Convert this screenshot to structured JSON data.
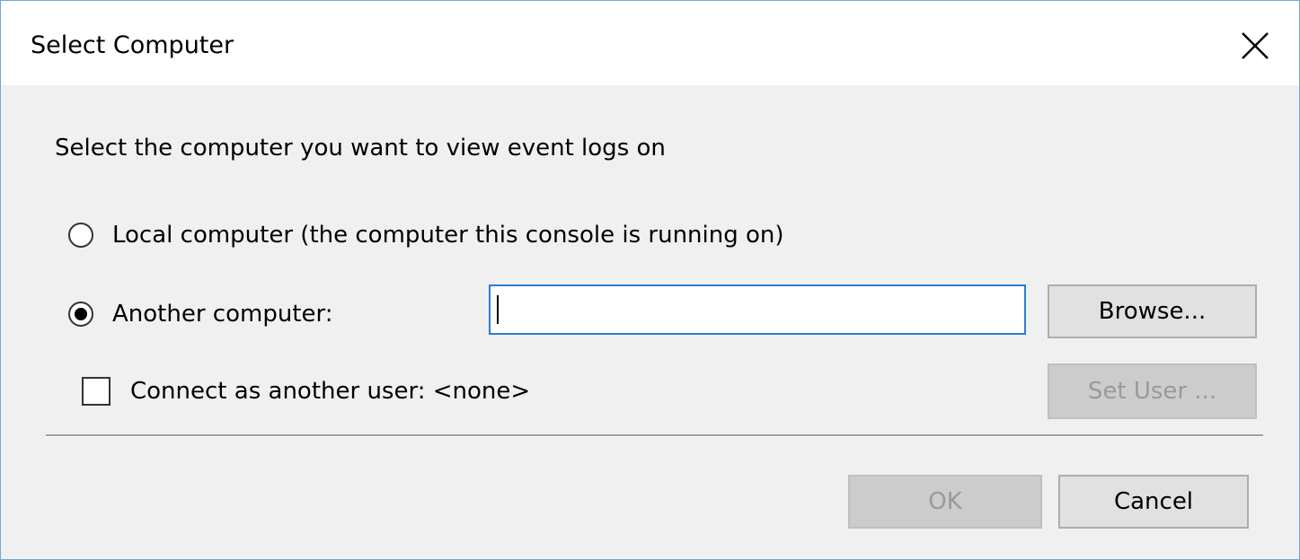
{
  "dialog": {
    "title": "Select Computer",
    "close_icon": "close-icon"
  },
  "prompt": "Select the computer you want to view event logs on",
  "options": {
    "local": {
      "label": "Local computer (the computer this console is running on)",
      "selected": false
    },
    "another": {
      "label": "Another computer:",
      "selected": true
    }
  },
  "computer_input": {
    "value": "",
    "placeholder": ""
  },
  "buttons": {
    "browse": "Browse...",
    "set_user": "Set User ...",
    "ok": "OK",
    "cancel": "Cancel"
  },
  "connect_as": {
    "label": "Connect as another user: <none>",
    "checked": false
  },
  "colors": {
    "accent": "#2b7bd6",
    "window_border": "#6fa8dc",
    "background": "#f0f0f0",
    "disabled_text": "#9a9a9a"
  }
}
